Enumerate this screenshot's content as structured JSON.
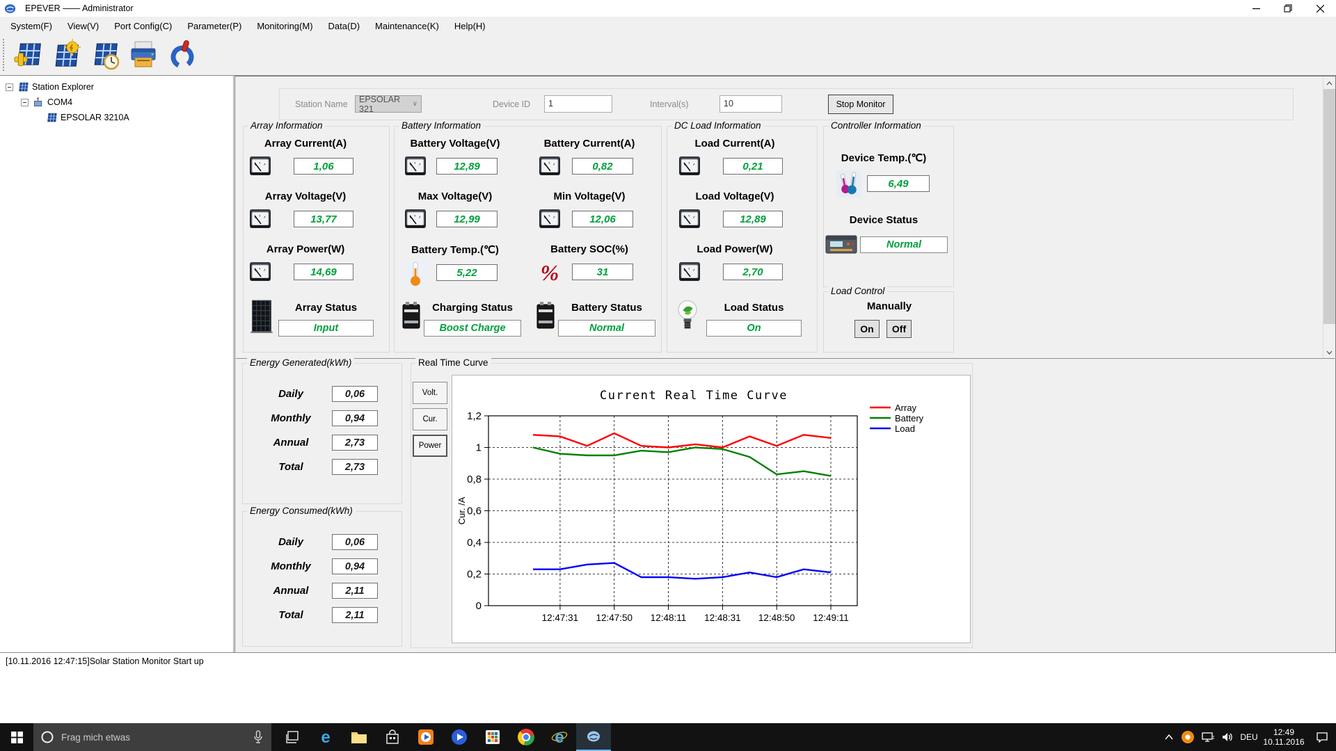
{
  "colors": {
    "value_green": "#00A03C",
    "taskbar_accent": "#76B9ED"
  },
  "window": {
    "title": "EPEVER —— Administrator"
  },
  "menu": {
    "items": [
      {
        "label": "System(F)"
      },
      {
        "label": "View(V)"
      },
      {
        "label": "Port Config(C)"
      },
      {
        "label": "Parameter(P)"
      },
      {
        "label": "Monitoring(M)"
      },
      {
        "label": "Data(D)"
      },
      {
        "label": "Maintenance(K)"
      },
      {
        "label": "Help(H)"
      }
    ]
  },
  "tree": {
    "root": "Station Explorer",
    "port": "COM4",
    "device": "EPSOLAR 3210A"
  },
  "controls": {
    "station_name_label": "Station Name",
    "station_name_value": "EPSOLAR 321",
    "device_id_label": "Device ID",
    "device_id_value": "1",
    "interval_label": "Interval(s)",
    "interval_value": "10",
    "stop_button": "Stop Monitor"
  },
  "array_info": {
    "title": "Array Information",
    "metrics": [
      {
        "label": "Array Current(A)",
        "value": "1,06"
      },
      {
        "label": "Array Voltage(V)",
        "value": "13,77"
      },
      {
        "label": "Array Power(W)",
        "value": "14,69"
      }
    ],
    "status_label": "Array Status",
    "status_value": "Input"
  },
  "battery_info": {
    "title": "Battery Information",
    "metrics": [
      {
        "label": "Battery Voltage(V)",
        "value": "12,89"
      },
      {
        "label": "Battery Current(A)",
        "value": "0,82"
      },
      {
        "label": "Max Voltage(V)",
        "value": "12,99"
      },
      {
        "label": "Min Voltage(V)",
        "value": "12,06"
      },
      {
        "label": "Battery Temp.(℃)",
        "value": "5,22"
      },
      {
        "label": "Battery SOC(%)",
        "value": "31"
      }
    ],
    "charging_status_label": "Charging Status",
    "charging_status_value": "Boost Charge",
    "battery_status_label": "Battery Status",
    "battery_status_value": "Normal"
  },
  "load_info": {
    "title": "DC Load Information",
    "metrics": [
      {
        "label": "Load Current(A)",
        "value": "0,21"
      },
      {
        "label": "Load Voltage(V)",
        "value": "12,89"
      },
      {
        "label": "Load Power(W)",
        "value": "2,70"
      }
    ],
    "status_label": "Load Status",
    "status_value": "On"
  },
  "controller_info": {
    "title": "Controller Information",
    "temp_label": "Device Temp.(℃)",
    "temp_value": "6,49",
    "status_label": "Device Status",
    "status_value": "Normal"
  },
  "load_control": {
    "title": "Load Control",
    "mode_label": "Manually",
    "on_button": "On",
    "off_button": "Off"
  },
  "energy_generated": {
    "title": "Energy Generated(kWh)",
    "rows": [
      {
        "label": "Daily",
        "value": "0,06"
      },
      {
        "label": "Monthly",
        "value": "0,94"
      },
      {
        "label": "Annual",
        "value": "2,73"
      },
      {
        "label": "Total",
        "value": "2,73"
      }
    ]
  },
  "energy_consumed": {
    "title": "Energy Consumed(kWh)",
    "rows": [
      {
        "label": "Daily",
        "value": "0,06"
      },
      {
        "label": "Monthly",
        "value": "0,94"
      },
      {
        "label": "Annual",
        "value": "2,11"
      },
      {
        "label": "Total",
        "value": "2,11"
      }
    ]
  },
  "curve_panel": {
    "title": "Real Time Curve",
    "tabs": [
      {
        "label": "Volt."
      },
      {
        "label": "Cur."
      },
      {
        "label": "Power"
      }
    ]
  },
  "chart_data": {
    "type": "line",
    "title": "Current Real Time Curve",
    "ylabel": "Cur. /A",
    "ylim": [
      0,
      1.2
    ],
    "yticks": [
      0,
      0.2,
      0.4,
      0.6,
      0.8,
      1,
      1.2
    ],
    "ytick_labels": [
      "0",
      "0,2",
      "0,4",
      "0,6",
      "0,8",
      "1",
      "1,2"
    ],
    "grid": "dashed",
    "legend_position": "right-top",
    "x_ticks": [
      {
        "index": 1,
        "label": "12:47:31"
      },
      {
        "index": 3,
        "label": "12:47:50"
      },
      {
        "index": 5,
        "label": "12:48:11"
      },
      {
        "index": 7,
        "label": "12:48:31"
      },
      {
        "index": 9,
        "label": "12:48:50"
      },
      {
        "index": 11,
        "label": "12:49:11"
      }
    ],
    "series": [
      {
        "name": "Array",
        "color": "#ff0000",
        "values": [
          1.08,
          1.07,
          1.01,
          1.09,
          1.01,
          1.0,
          1.02,
          1.0,
          1.07,
          1.01,
          1.08,
          1.06
        ]
      },
      {
        "name": "Battery",
        "color": "#008000",
        "values": [
          1.0,
          0.96,
          0.95,
          0.95,
          0.98,
          0.97,
          1.0,
          0.99,
          0.94,
          0.83,
          0.85,
          0.82
        ]
      },
      {
        "name": "Load",
        "color": "#0000ff",
        "values": [
          0.23,
          0.23,
          0.26,
          0.27,
          0.18,
          0.18,
          0.17,
          0.18,
          0.21,
          0.18,
          0.23,
          0.21
        ]
      }
    ]
  },
  "log": {
    "line": "[10.11.2016 12:47:15]Solar Station Monitor Start up"
  },
  "taskbar": {
    "search_placeholder": "Frag mich etwas",
    "language": "DEU",
    "time": "12:49",
    "date": "10.11.2016"
  }
}
